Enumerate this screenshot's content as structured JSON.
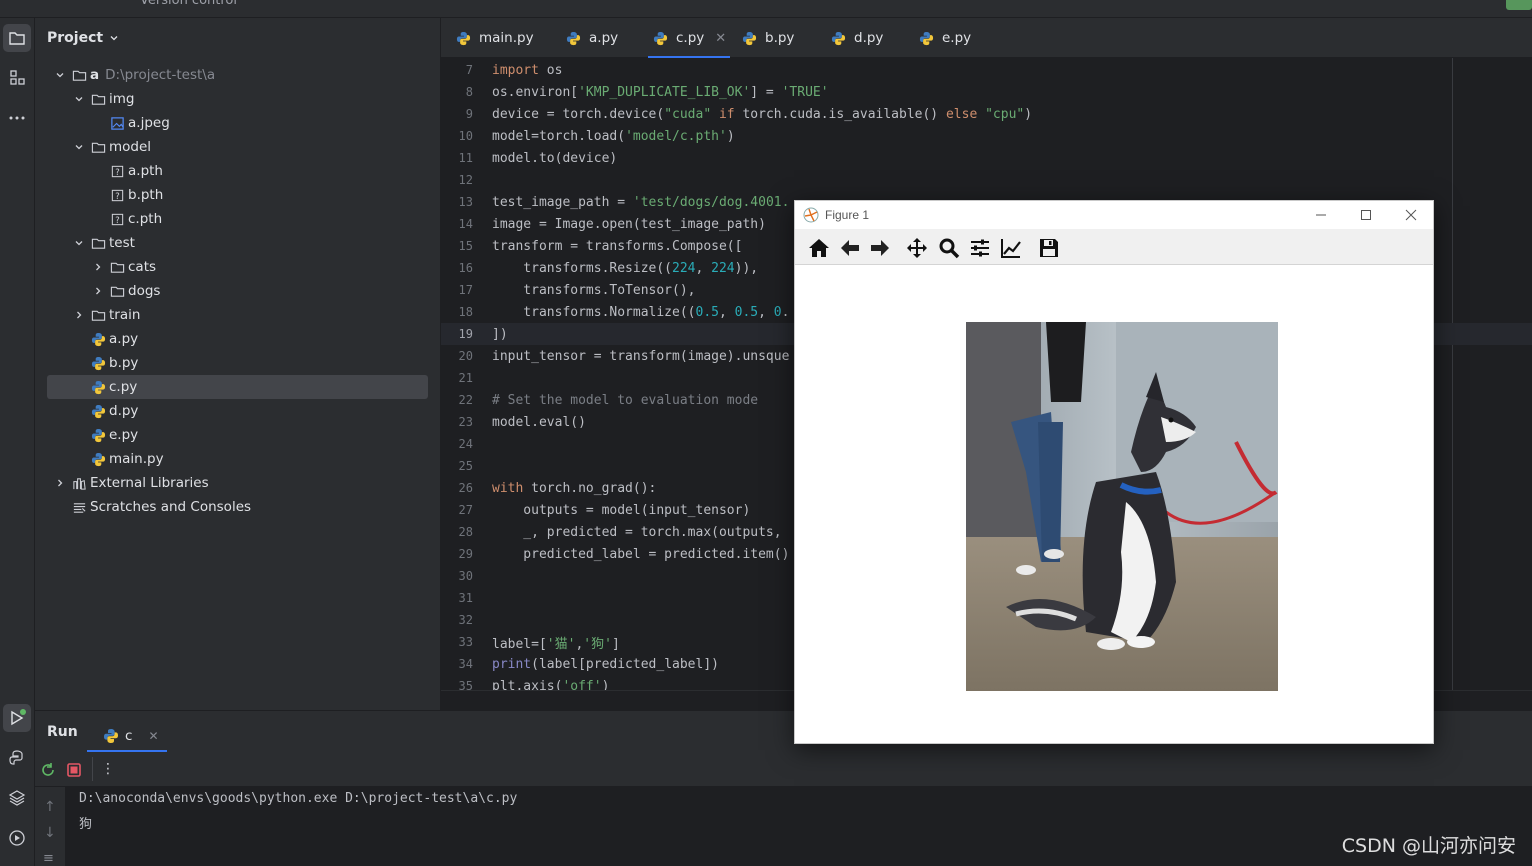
{
  "topbar": {
    "vcs_label": "Version control"
  },
  "project": {
    "header": "Project",
    "tree": [
      {
        "name": "a",
        "hint": "D:\\project-test\\a",
        "type": "folder",
        "depth": 0,
        "expanded": true
      },
      {
        "name": "img",
        "type": "folder",
        "depth": 1,
        "expanded": true
      },
      {
        "name": "a.jpeg",
        "type": "image",
        "depth": 2
      },
      {
        "name": "model",
        "type": "folder",
        "depth": 1,
        "expanded": true
      },
      {
        "name": "a.pth",
        "type": "unknown",
        "depth": 2
      },
      {
        "name": "b.pth",
        "type": "unknown",
        "depth": 2
      },
      {
        "name": "c.pth",
        "type": "unknown",
        "depth": 2
      },
      {
        "name": "test",
        "type": "folder",
        "depth": 1,
        "expanded": true
      },
      {
        "name": "cats",
        "type": "folder",
        "depth": 2,
        "expanded": false
      },
      {
        "name": "dogs",
        "type": "folder",
        "depth": 2,
        "expanded": false
      },
      {
        "name": "train",
        "type": "folder",
        "depth": 1,
        "expanded": false
      },
      {
        "name": "a.py",
        "type": "python",
        "depth": 1
      },
      {
        "name": "b.py",
        "type": "python",
        "depth": 1
      },
      {
        "name": "c.py",
        "type": "python",
        "depth": 1,
        "selected": true
      },
      {
        "name": "d.py",
        "type": "python",
        "depth": 1
      },
      {
        "name": "e.py",
        "type": "python",
        "depth": 1
      },
      {
        "name": "main.py",
        "type": "python",
        "depth": 1
      },
      {
        "name": "External Libraries",
        "type": "library",
        "depth": 0,
        "expanded": false
      },
      {
        "name": "Scratches and Consoles",
        "type": "scratch",
        "depth": 0
      }
    ]
  },
  "tabs": [
    {
      "label": "main.py"
    },
    {
      "label": "a.py"
    },
    {
      "label": "c.py",
      "active": true
    },
    {
      "label": "b.py"
    },
    {
      "label": "d.py"
    },
    {
      "label": "e.py"
    }
  ],
  "editor": {
    "current_line": "19",
    "lines": [
      {
        "n": "7",
        "text": "import os"
      },
      {
        "n": "8",
        "text": "os.environ['KMP_DUPLICATE_LIB_OK'] = 'TRUE'"
      },
      {
        "n": "9",
        "text": "device = torch.device(\"cuda\" if torch.cuda.is_available() else \"cpu\")"
      },
      {
        "n": "10",
        "text": "model=torch.load('model/c.pth')"
      },
      {
        "n": "11",
        "text": "model.to(device)"
      },
      {
        "n": "12",
        "text": ""
      },
      {
        "n": "13",
        "text": "test_image_path = 'test/dogs/dog.4001."
      },
      {
        "n": "14",
        "text": "image = Image.open(test_image_path)"
      },
      {
        "n": "15",
        "text": "transform = transforms.Compose(["
      },
      {
        "n": "16",
        "text": "    transforms.Resize((224, 224)),"
      },
      {
        "n": "17",
        "text": "    transforms.ToTensor(),"
      },
      {
        "n": "18",
        "text": "    transforms.Normalize((0.5, 0.5, 0."
      },
      {
        "n": "19",
        "text": "])"
      },
      {
        "n": "20",
        "text": "input_tensor = transform(image).unsque"
      },
      {
        "n": "21",
        "text": ""
      },
      {
        "n": "22",
        "text": "# Set the model to evaluation mode"
      },
      {
        "n": "23",
        "text": "model.eval()"
      },
      {
        "n": "24",
        "text": ""
      },
      {
        "n": "25",
        "text": ""
      },
      {
        "n": "26",
        "text": "with torch.no_grad():"
      },
      {
        "n": "27",
        "text": "    outputs = model(input_tensor)"
      },
      {
        "n": "28",
        "text": "    _, predicted = torch.max(outputs,"
      },
      {
        "n": "29",
        "text": "    predicted_label = predicted.item()"
      },
      {
        "n": "30",
        "text": ""
      },
      {
        "n": "31",
        "text": ""
      },
      {
        "n": "32",
        "text": ""
      },
      {
        "n": "33",
        "text": "label=['猫','狗']"
      },
      {
        "n": "34",
        "text": "print(label[predicted_label])"
      },
      {
        "n": "35",
        "text": "plt.axis('off')"
      }
    ]
  },
  "run": {
    "title": "Run",
    "tab_label": "c",
    "output": [
      "D:\\anoconda\\envs\\goods\\python.exe D:\\project-test\\a\\c.py",
      "狗"
    ]
  },
  "figure": {
    "title": "Figure 1",
    "toolbar": [
      "home-icon",
      "back-icon",
      "forward-icon",
      "pan-icon",
      "zoom-icon",
      "configure-subplots-icon",
      "edit-axis-icon",
      "save-icon"
    ]
  },
  "watermark": "CSDN @山河亦问安",
  "colors": {
    "background": "#1e1f22",
    "panel": "#2b2d30",
    "accent": "#3574f0",
    "keyword": "#cf8e6d",
    "string": "#6aab73",
    "number": "#2aacb8",
    "comment": "#7a7e85"
  }
}
